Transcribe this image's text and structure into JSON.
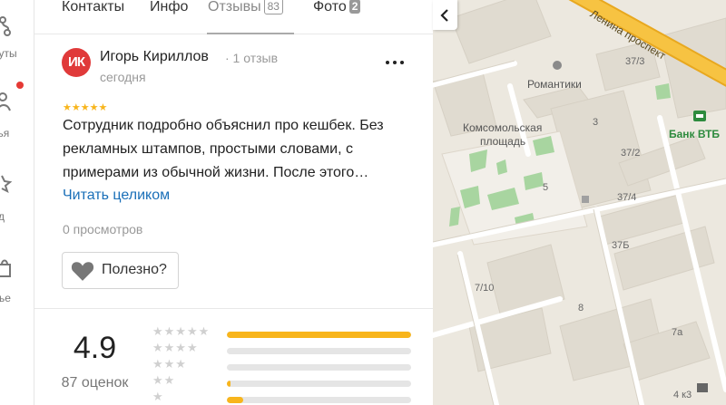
{
  "sidebar": {
    "items": [
      {
        "label": "руты",
        "icon": "route-icon"
      },
      {
        "label": "зья",
        "icon": "friends-icon"
      },
      {
        "label": "д",
        "icon": "star-icon"
      },
      {
        "label": "лье",
        "icon": "bag-icon"
      }
    ]
  },
  "tabs": [
    {
      "label": "Контакты"
    },
    {
      "label": "Инфо"
    },
    {
      "label": "Отзывы",
      "badge": "83"
    },
    {
      "label": "Фото",
      "badge": "2"
    }
  ],
  "review": {
    "avatar_initials": "ИК",
    "avatar_color": "#e03a3a",
    "author": "Игорь Кириллов",
    "author_meta": "· 1 отзыв",
    "date": "сегодня",
    "rating_stars": 5,
    "text": "Сотрудник подробно объяснил про кешбек. Без рекламных штампов, простыми словами, с примерами из обычной жизни. После этого…",
    "read_more": "Читать целиком",
    "views": "0 просмотров",
    "useful_label": "Полезно?"
  },
  "summary": {
    "rating": "4.9",
    "count": "87 оценок",
    "distribution": [
      {
        "stars": 5,
        "fraction": 1.0
      },
      {
        "stars": 4,
        "fraction": 0.0
      },
      {
        "stars": 3,
        "fraction": 0.0
      },
      {
        "stars": 2,
        "fraction": 0.01
      },
      {
        "stars": 1,
        "fraction": 0.09
      }
    ]
  },
  "map": {
    "labels": [
      {
        "text": "Ленина проспект"
      },
      {
        "text": "Романтики"
      },
      {
        "text": "Комсомольская"
      },
      {
        "text": "площадь"
      },
      {
        "text": "Банк ВТБ"
      },
      {
        "text": "37/3"
      },
      {
        "text": "37/2"
      },
      {
        "text": "37/4"
      },
      {
        "text": "37Б"
      },
      {
        "text": "7/10"
      },
      {
        "text": "3"
      },
      {
        "text": "5"
      },
      {
        "text": "8"
      },
      {
        "text": "7а"
      },
      {
        "text": "4 к3"
      }
    ]
  },
  "colors": {
    "accent_star": "#f8b51c",
    "link": "#1a6fb8",
    "road_main": "#f7c342"
  }
}
